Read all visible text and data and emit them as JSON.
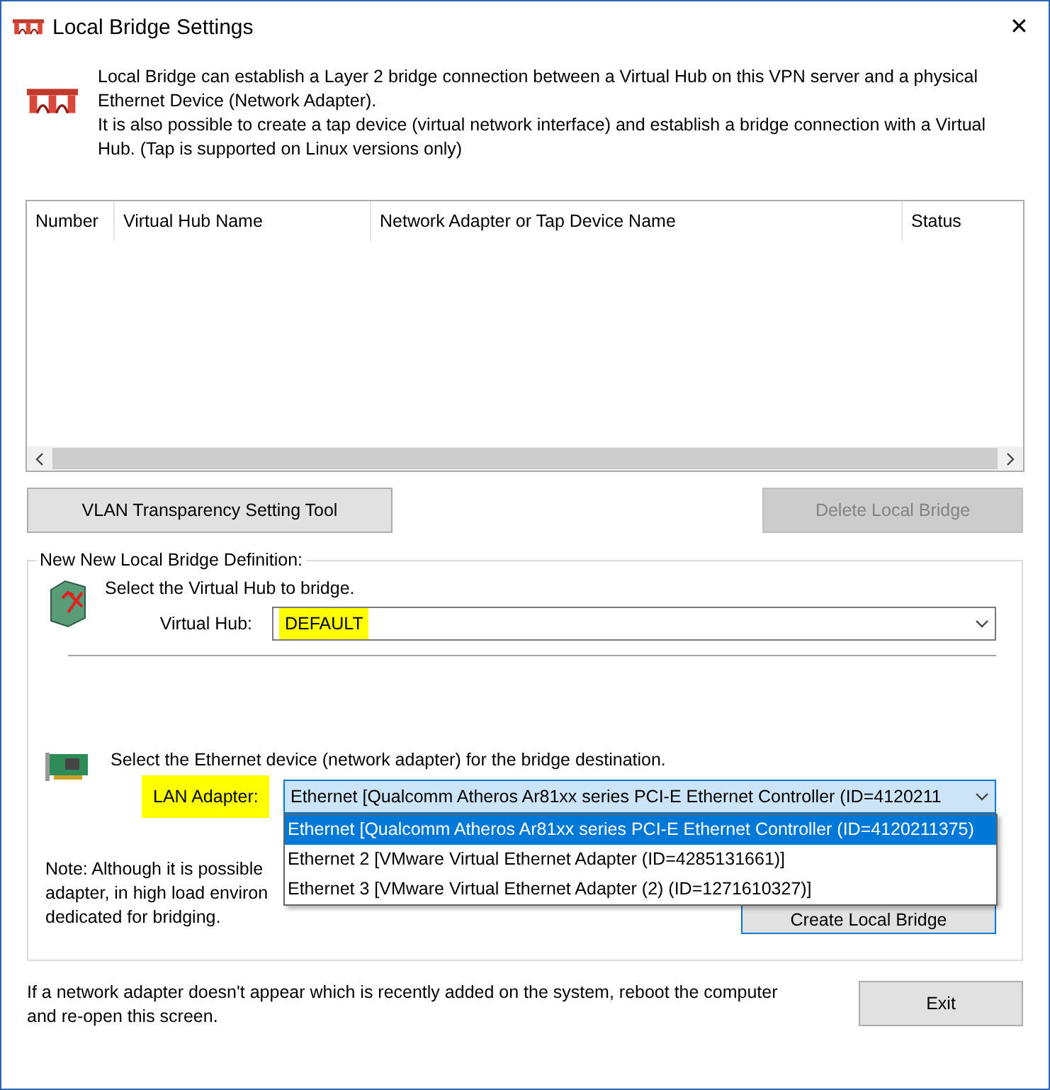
{
  "window": {
    "title": "Local Bridge Settings",
    "close": "✕"
  },
  "intro": [
    "Local Bridge can establish a Layer 2 bridge connection between a Virtual Hub on this VPN server and a physical Ethernet Device (Network Adapter).",
    "It is also possible to create a tap device (virtual network interface) and establish a bridge connection with a Virtual Hub. (Tap is supported on Linux versions only)"
  ],
  "table": {
    "columns": [
      "Number",
      "Virtual Hub Name",
      "Network Adapter or Tap Device Name",
      "Status"
    ]
  },
  "buttons": [
    {
      "label": "VLAN Transparency Setting Tool",
      "disabled": false
    },
    {
      "label": "Delete Local Bridge",
      "disabled": true
    }
  ],
  "definition": {
    "title": "New New Local Bridge Definition:",
    "hub_prompt": "Select the Virtual Hub to bridge.",
    "hub_label": "Virtual Hub:",
    "hub_value": "DEFAULT",
    "adapter_prompt": "Select the Ethernet device (network adapter) for the bridge destination.",
    "adapter_label": "LAN Adapter:",
    "adapter_value": "Ethernet [Qualcomm Atheros Ar81xx series PCI-E Ethernet Controller (ID=4120211",
    "adapter_options": [
      {
        "label": "Ethernet [Qualcomm Atheros Ar81xx series PCI-E Ethernet Controller (ID=4120211375)",
        "selected": true
      },
      {
        "label": "Ethernet 2 [VMware Virtual Ethernet Adapter (ID=4285131661)]",
        "selected": false
      },
      {
        "label": "Ethernet 3 [VMware Virtual Ethernet Adapter (2) (ID=1271610327)]",
        "selected": false
      }
    ],
    "note_lines": [
      "Note: Although it is possible",
      "adapter, in high load environ",
      "dedicated for bridging."
    ],
    "create_button": "Create Local Bridge"
  },
  "footer": {
    "text": "If a network adapter doesn't appear which is recently added on the system, reboot the computer and re-open this screen.",
    "exit": "Exit"
  }
}
